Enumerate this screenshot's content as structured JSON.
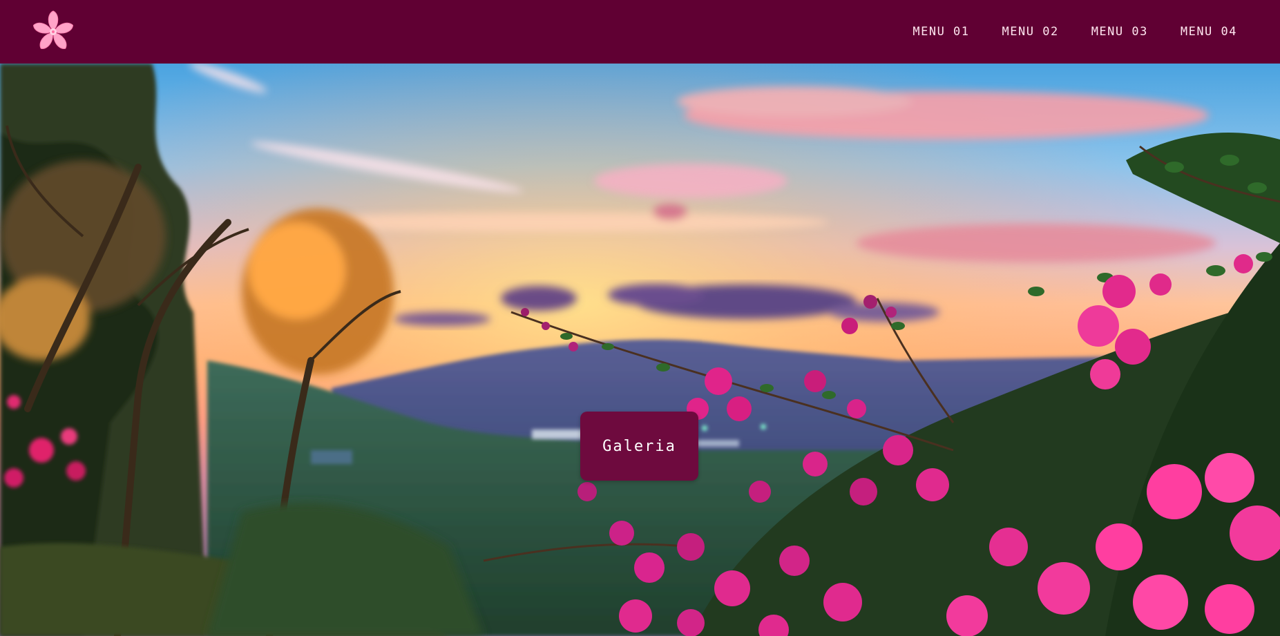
{
  "header": {
    "logo_icon": "cherry-blossom-icon",
    "menu": [
      {
        "label": "MENU 01"
      },
      {
        "label": "MENU 02"
      },
      {
        "label": "MENU 03"
      },
      {
        "label": "MENU 04"
      }
    ]
  },
  "hero": {
    "background": "sunset-landscape-with-bougainvillea",
    "button_label": "Galeria"
  },
  "colors": {
    "navbar": "#600033",
    "button": "#6e0a3e",
    "logo_petal": "#ff9ec4"
  }
}
